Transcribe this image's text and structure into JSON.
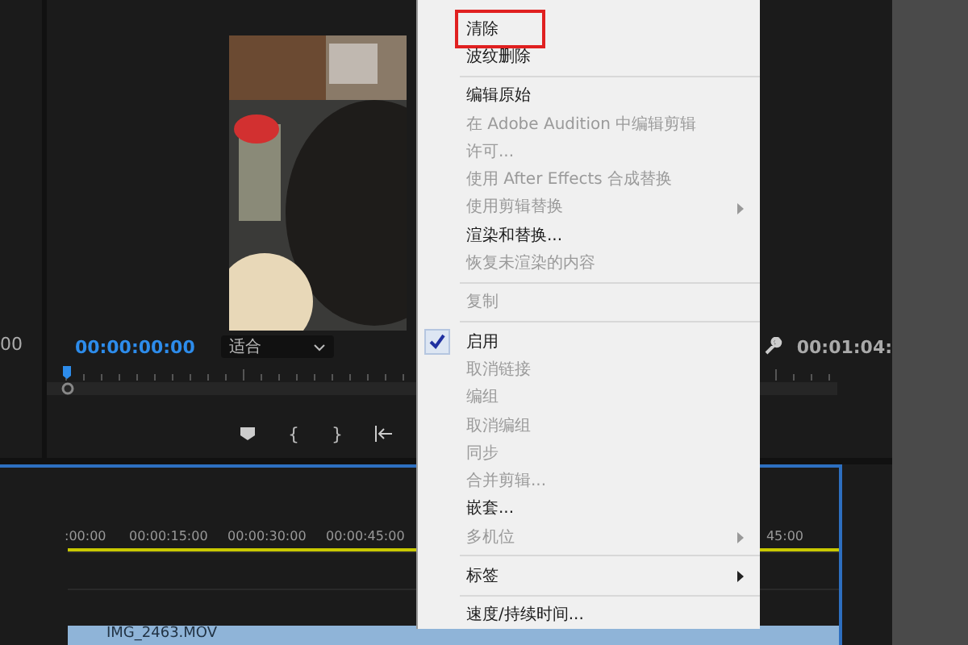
{
  "source_monitor": {
    "timecode": "00"
  },
  "program_monitor": {
    "timecode": "00:00:00:00",
    "zoom": "适合",
    "duration": "00:01:04:",
    "controls": [
      "{",
      "}"
    ]
  },
  "timeline": {
    "ruler": [
      ":00:00",
      "00:00:15:00",
      "00:00:30:00",
      "00:00:45:00"
    ],
    "ruler_end": "45:00",
    "clip": "IMG_2463.MOV"
  },
  "context_menu": [
    {
      "kind": "item",
      "label": "清除",
      "disabled": false,
      "checked": false,
      "submenu": false,
      "marked": true
    },
    {
      "kind": "item",
      "label": "波纹删除",
      "disabled": false,
      "checked": false,
      "submenu": false,
      "marked": false
    },
    {
      "kind": "separator"
    },
    {
      "kind": "item",
      "label": "编辑原始",
      "disabled": false,
      "checked": false,
      "submenu": false,
      "marked": false
    },
    {
      "kind": "item",
      "label": "在 Adobe Audition 中编辑剪辑",
      "disabled": true,
      "checked": false,
      "submenu": false,
      "marked": false
    },
    {
      "kind": "item",
      "label": "许可...",
      "disabled": true,
      "checked": false,
      "submenu": false,
      "marked": false
    },
    {
      "kind": "item",
      "label": "使用 After Effects 合成替换",
      "disabled": true,
      "checked": false,
      "submenu": false,
      "marked": false
    },
    {
      "kind": "item",
      "label": "使用剪辑替换",
      "disabled": true,
      "checked": false,
      "submenu": true,
      "marked": false
    },
    {
      "kind": "item",
      "label": "渲染和替换...",
      "disabled": false,
      "checked": false,
      "submenu": false,
      "marked": false
    },
    {
      "kind": "item",
      "label": "恢复未渲染的内容",
      "disabled": true,
      "checked": false,
      "submenu": false,
      "marked": false
    },
    {
      "kind": "separator"
    },
    {
      "kind": "item",
      "label": "复制",
      "disabled": true,
      "checked": false,
      "submenu": false,
      "marked": false
    },
    {
      "kind": "separator"
    },
    {
      "kind": "item",
      "label": "启用",
      "disabled": false,
      "checked": true,
      "submenu": false,
      "marked": false
    },
    {
      "kind": "item",
      "label": "取消链接",
      "disabled": true,
      "checked": false,
      "submenu": false,
      "marked": false
    },
    {
      "kind": "item",
      "label": "编组",
      "disabled": true,
      "checked": false,
      "submenu": false,
      "marked": false
    },
    {
      "kind": "item",
      "label": "取消编组",
      "disabled": true,
      "checked": false,
      "submenu": false,
      "marked": false
    },
    {
      "kind": "item",
      "label": "同步",
      "disabled": true,
      "checked": false,
      "submenu": false,
      "marked": false
    },
    {
      "kind": "item",
      "label": "合并剪辑...",
      "disabled": true,
      "checked": false,
      "submenu": false,
      "marked": false
    },
    {
      "kind": "item",
      "label": "嵌套...",
      "disabled": false,
      "checked": false,
      "submenu": false,
      "marked": false
    },
    {
      "kind": "item",
      "label": "多机位",
      "disabled": true,
      "checked": false,
      "submenu": true,
      "marked": false
    },
    {
      "kind": "separator"
    },
    {
      "kind": "item",
      "label": "标签",
      "disabled": false,
      "checked": false,
      "submenu": true,
      "marked": false
    },
    {
      "kind": "separator"
    },
    {
      "kind": "item",
      "label": "速度/持续时间...",
      "disabled": false,
      "checked": false,
      "submenu": false,
      "marked": false
    }
  ]
}
